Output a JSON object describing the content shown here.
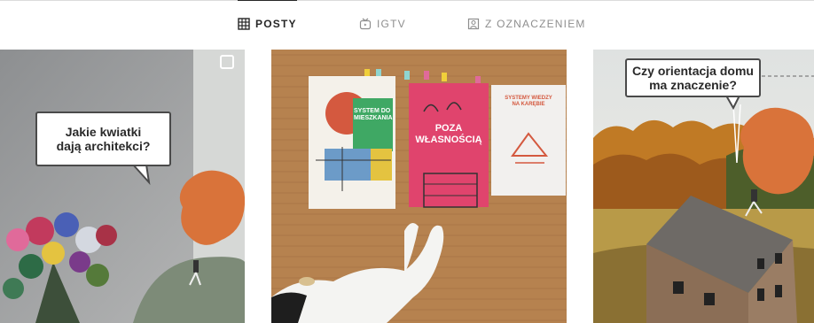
{
  "tabs": [
    {
      "label": "POSTY",
      "icon": "grid-icon",
      "active": true
    },
    {
      "label": "IGTV",
      "icon": "igtv-icon",
      "active": false
    },
    {
      "label": "Z OZNACZENIEM",
      "icon": "tagged-icon",
      "active": false
    }
  ],
  "posts": [
    {
      "speech": "Jakie kwiatki dają architekci?",
      "speech_line1": "Jakie kwiatki",
      "speech_line2": "dają architekci?",
      "badge_icon": "multi-post-icon"
    },
    {
      "books": [
        {
          "title": "SYSTEM DO MIESZKANIA"
        },
        {
          "title": "POZA WŁASNOŚCIĄ",
          "title_line1": "POZA",
          "title_line2": "WŁASNOŚCIĄ"
        },
        {
          "title": "SYSTEMY WIEDZY NA KARĘBIE"
        }
      ]
    },
    {
      "speech": "Czy orientacja domu ma znaczenie?",
      "speech_line1": "Czy orientacja domu",
      "speech_line2": "ma znaczenie?"
    }
  ],
  "colors": {
    "text_active": "#262626",
    "text_inactive": "#8e8e8e",
    "divider": "#dbdbdb",
    "avatar_orange": "#d9733a"
  }
}
